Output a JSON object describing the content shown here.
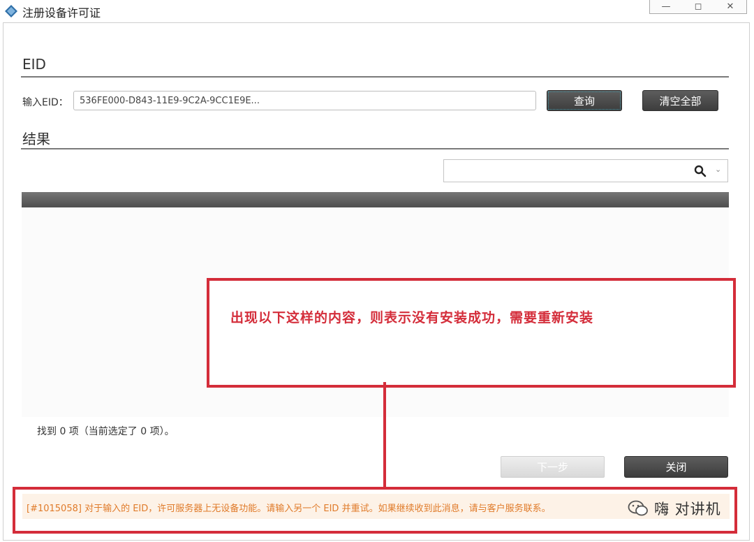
{
  "window": {
    "title": "注册设备许可证",
    "icon": "diamond-app-icon",
    "controls": {
      "minimize": "▭",
      "maximize": "◻",
      "close": "✕"
    }
  },
  "eid_section": {
    "heading": "EID",
    "input_label": "输入EID：",
    "input_value": "536FE000-D843-11E9-9C2A-9CC1E9E...",
    "query_label": "查询",
    "clear_label": "清空全部"
  },
  "results_section": {
    "heading": "结果",
    "search_value": "",
    "search_icon": "search-icon",
    "found_text": "找到 0 项（当前选定了 0 项）。"
  },
  "annotation": {
    "text": "出现以下这样的内容，则表示没有安装成功，需要重新安装",
    "color": "#d42d3a"
  },
  "footer": {
    "next_label": "下一步",
    "close_label": "关闭"
  },
  "message": {
    "text": "[#1015058] 对于输入的 EID，许可服务器上无设备功能。请输入另一个 EID 并重试。如果继续收到此消息，请与客户服务联系。",
    "color": "#e07b2a"
  },
  "watermark": {
    "text": "嗨 对讲机"
  }
}
